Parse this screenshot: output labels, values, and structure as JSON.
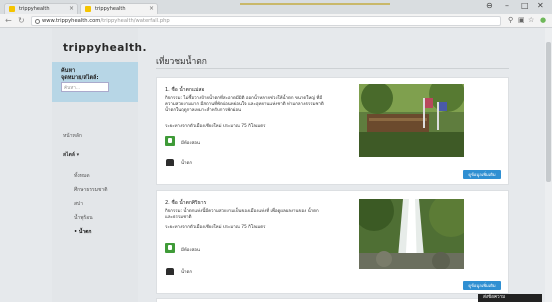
{
  "browser": {
    "tabs": [
      {
        "label": "trippyhealth"
      },
      {
        "label": "trippyhealth"
      }
    ],
    "window_controls": {
      "minimize": "–",
      "maximize": "□",
      "close": "✕",
      "profile": "⊖"
    },
    "url_host": "www.trippyhealth.com",
    "url_path": "/trippyhealth/waterfall.php"
  },
  "sidebar": {
    "brand": "trippyhealth.",
    "search_line1": "ค้นหา",
    "search_line2": "จุดหมาย/สไตล์:",
    "search_placeholder": "ค้นหา...",
    "home": "หน้าหลัก",
    "style": "สไตล์ ▾",
    "items": [
      {
        "label": "ทั้งหมด"
      },
      {
        "label": "ศึกษาธรรมชาติ"
      },
      {
        "label": "สปา"
      },
      {
        "label": "น้ำพุร้อน"
      },
      {
        "label": "• น้ำตก"
      }
    ]
  },
  "content": {
    "heading": "เที่ยวชมน้ำตก",
    "cards": [
      {
        "title": "1. ชื่อ น้ำตกแม่สอ",
        "desc": "กิจกรรม: ไม่ซื้อวางป้ายน้ำตกที่สะอาดมีมิติ ออกน้ำหลายช่วงให้น้ำตก ขนาดใหญ่ ที่มีความสวยงามมาก มีสถานที่พักผ่อนหย่อนใจ และอุทยานแห่งชาติ ท่ามกลางธรรมชาติ น้ำตกในฤดูกาลเหมาะสำหรับการพักผ่อน",
        "distance": "ระยะทางจากตัวเมืองเชียงใหม่ ประมาณ 75 กิโลเมตร",
        "category": "มีห้องสอน",
        "type": "น้ำตก",
        "more": "ดูข้อมูลเพิ่มเติม"
      },
      {
        "title": "2. ชื่อ น้ำตกศิริธาร",
        "desc": "กิจกรรม: น้ำตกแห่งนี้มีความสวยงามเป็นของเมืองแห่งที่ เพื่อดูผลผลงานของ น้ำตกและธรรมชาติ",
        "distance": "ระยะทางจากตัวเมืองเชียงใหม่ ประมาณ 75 กิโลเมตร",
        "category": "มีห้องสอน",
        "type": "น้ำตก",
        "more": "ดูข้อมูลเพิ่มเติม"
      }
    ]
  },
  "chat": {
    "label": "ส่งข้อความ"
  },
  "colors": {
    "search_panel": "#b7d6e6",
    "button": "#2f8fd2",
    "category_icon": "#3f9b38"
  }
}
